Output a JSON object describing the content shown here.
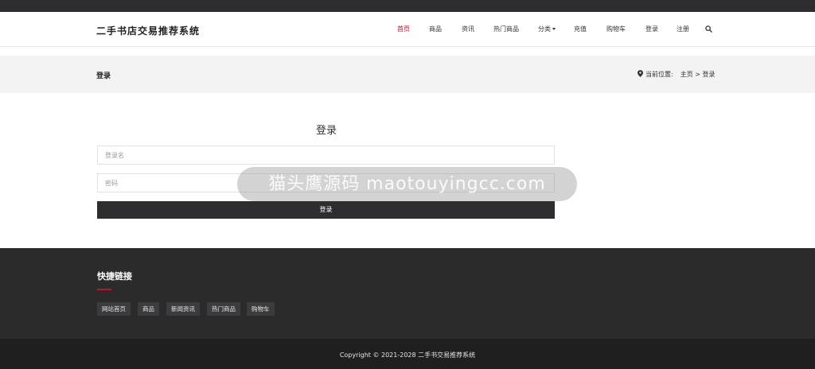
{
  "header": {
    "brand": "二手书店交易推荐系统",
    "nav": [
      {
        "label": "首页",
        "active": true
      },
      {
        "label": "商品",
        "active": false
      },
      {
        "label": "资讯",
        "active": false
      },
      {
        "label": "热门商品",
        "active": false
      },
      {
        "label": "分类",
        "active": false,
        "dropdown": true
      },
      {
        "label": "充值",
        "active": false
      },
      {
        "label": "购物车",
        "active": false
      },
      {
        "label": "登录",
        "active": false
      },
      {
        "label": "注册",
        "active": false
      }
    ],
    "search_icon": "search-icon"
  },
  "banner": {
    "title": "登录",
    "location_label": "当前位置:",
    "breadcrumb": "主页 > 登录"
  },
  "login": {
    "title": "登录",
    "username_placeholder": "登录名",
    "password_placeholder": "密码",
    "submit_label": "登录"
  },
  "watermark": {
    "text": "猫头鹰源码 maotouyingcc.com"
  },
  "footer": {
    "title": "快捷链接",
    "links": [
      "网站首页",
      "商品",
      "新闻资讯",
      "热门商品",
      "购物车"
    ],
    "copyright": "Copyright © 2021-2028 二手书交易推荐系统"
  },
  "colors": {
    "accent": "#c8102e",
    "dark": "#2d2d2f",
    "banner_bg": "#f3f3f3"
  }
}
